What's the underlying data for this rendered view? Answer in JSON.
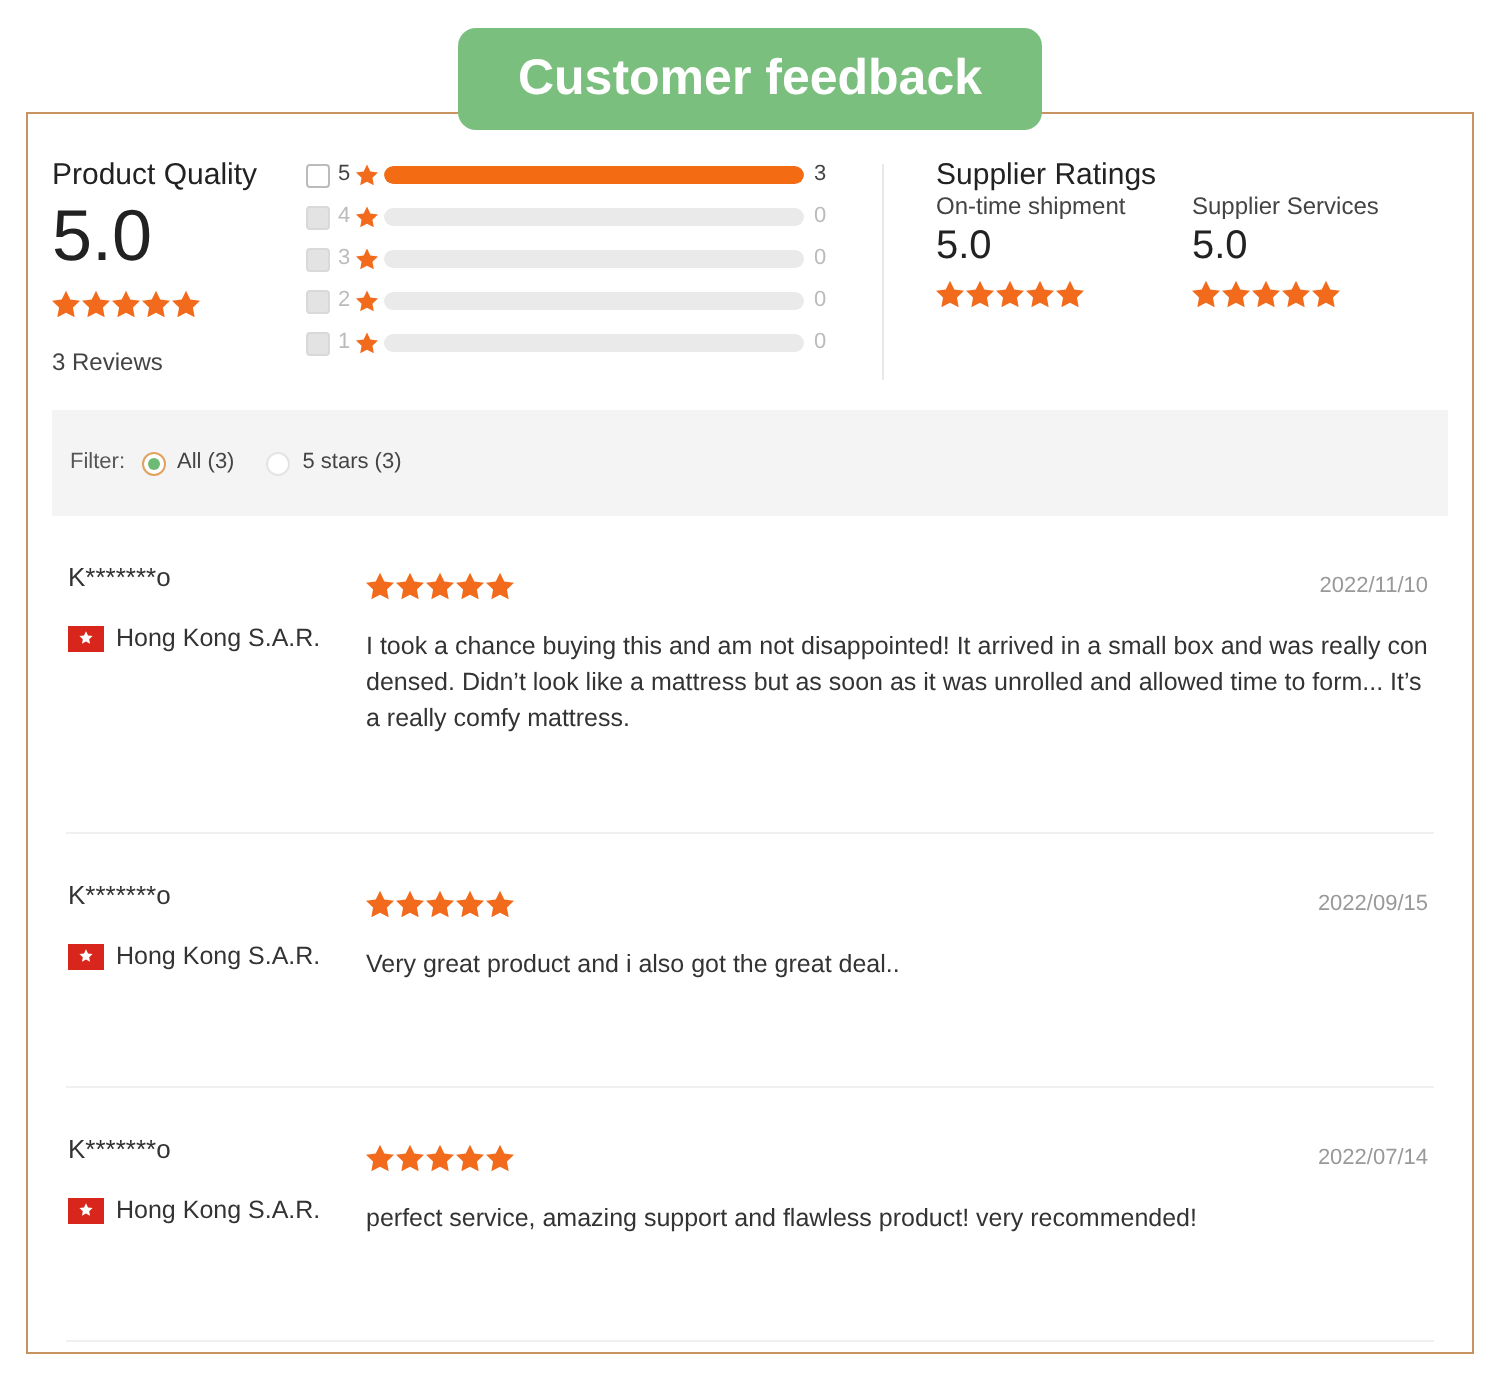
{
  "header": {
    "title": "Customer feedback"
  },
  "product_quality": {
    "label": "Product Quality",
    "score": "5.0",
    "stars": 5,
    "reviews": "3 Reviews"
  },
  "breakdown": [
    {
      "rating": "5",
      "count": "3",
      "level": 1,
      "disabled": false
    },
    {
      "rating": "4",
      "count": "0",
      "level": 0,
      "disabled": true
    },
    {
      "rating": "3",
      "count": "0",
      "level": 0,
      "disabled": true
    },
    {
      "rating": "2",
      "count": "0",
      "level": 0,
      "disabled": true
    },
    {
      "rating": "1",
      "count": "0",
      "level": 0,
      "disabled": true
    }
  ],
  "supplier_ratings": {
    "title": "Supplier Ratings",
    "items": [
      {
        "label": "On-time shipment",
        "score": "5.0",
        "stars": 5
      },
      {
        "label": "Supplier Services",
        "score": "5.0",
        "stars": 5
      }
    ]
  },
  "filter": {
    "label": "Filter:",
    "options": [
      {
        "label": "All (3)",
        "selected": true
      },
      {
        "label": "5 stars (3)",
        "selected": false
      }
    ]
  },
  "reviews": [
    {
      "name": "K*******o",
      "stars": 5,
      "date": "2022/11/10",
      "country": "Hong Kong S.A.R.",
      "text": "I took a chance buying this and am not disappointed! It arrived in a small box and was really condensed. Didn’t look like a mattress but as soon as it was unrolled and allowed time to form... It’s a really comfy mattress."
    },
    {
      "name": "K*******o",
      "stars": 5,
      "date": "2022/09/15",
      "country": "Hong Kong S.A.R.",
      "text": "Very great product and i also got the great deal.."
    },
    {
      "name": "K*******o",
      "stars": 5,
      "date": "2022/07/14",
      "country": "Hong Kong S.A.R.",
      "text": "perfect service, amazing support and flawless product! very recommended!"
    }
  ]
}
